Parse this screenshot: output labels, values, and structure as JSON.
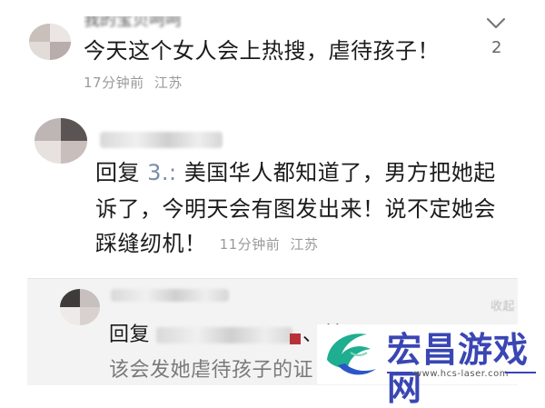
{
  "comments": [
    {
      "author_partial": "我的宝贝呵呵",
      "text": "今天这个女人会上热搜，虐待孩子！",
      "time": "17分钟前",
      "location": "江苏",
      "reply_count": "2"
    },
    {
      "reply_prefix": "回复",
      "mention": "3.:",
      "line1": "美国华人都知道了，男方把她起",
      "line2": "诉了，今明天会有图发出来！说不定她会",
      "line3": "踩缝纫机！",
      "time": "11分钟前",
      "location": "江苏"
    },
    {
      "reply_prefix": "回复",
      "mention_tail": "、美",
      "line2": "该会发她虐待孩子的证",
      "side_label": "收起"
    }
  ],
  "watermark": {
    "title": "宏昌游戏网",
    "url": "www.hcs-laser.com",
    "accent": "#3a46b4",
    "icon": "dragon-logo-icon"
  },
  "colors": {
    "text": "#1b1b1b",
    "meta": "#9a9a9a",
    "card": "#f3f3f3"
  }
}
